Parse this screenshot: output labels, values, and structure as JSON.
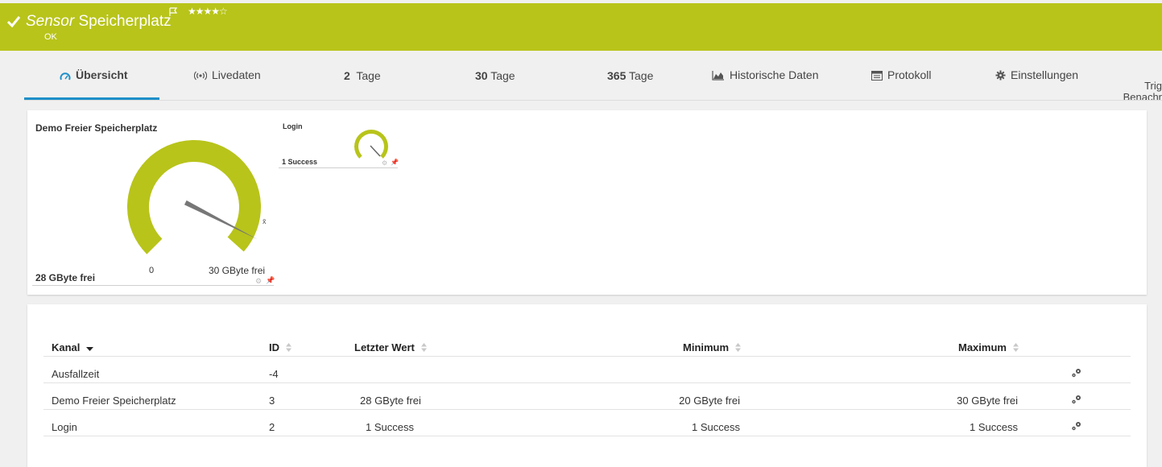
{
  "header": {
    "title_italic": "Sensor",
    "title_rest": "Speicherplatz",
    "stars": "★★★★☆",
    "status": "OK",
    "color": "#b8c41a"
  },
  "tabs": [
    {
      "label": "Übersicht",
      "icon": "gauge-icon"
    },
    {
      "label": "Livedaten",
      "icon": "broadcast-icon"
    },
    {
      "number": "2",
      "label": "Tage"
    },
    {
      "number": "30",
      "label": "Tage"
    },
    {
      "number": "365",
      "label": "Tage"
    },
    {
      "label": "Historische Daten",
      "icon": "area-chart-icon"
    },
    {
      "label": "Protokoll",
      "icon": "list-icon"
    },
    {
      "label": "Einstellungen",
      "icon": "gear-icon"
    },
    {
      "label_line1": "Trig",
      "label_line2": "Benachr"
    }
  ],
  "gauges": {
    "main": {
      "title": "Demo Freier Speicherplatz",
      "value_label": "28 GByte frei",
      "min_label": "0",
      "max_label": "30 GByte frei",
      "mean_symbol": "x̄",
      "value": 28,
      "max": 30
    },
    "small": {
      "title": "Login",
      "value_label": "1 Success"
    }
  },
  "table": {
    "headers": {
      "channel": "Kanal",
      "id": "ID",
      "last_value": "Letzter Wert",
      "minimum": "Minimum",
      "maximum": "Maximum"
    },
    "rows": [
      {
        "channel": "Ausfallzeit",
        "id": "-4",
        "last": "",
        "min": "",
        "max": ""
      },
      {
        "channel": "Demo Freier Speicherplatz",
        "id": "3",
        "last": "28 GByte frei",
        "min": "20 GByte frei",
        "max": "30 GByte frei"
      },
      {
        "channel": "Login",
        "id": "2",
        "last": "1 Success",
        "min": "1 Success",
        "max": "1 Success"
      }
    ]
  }
}
